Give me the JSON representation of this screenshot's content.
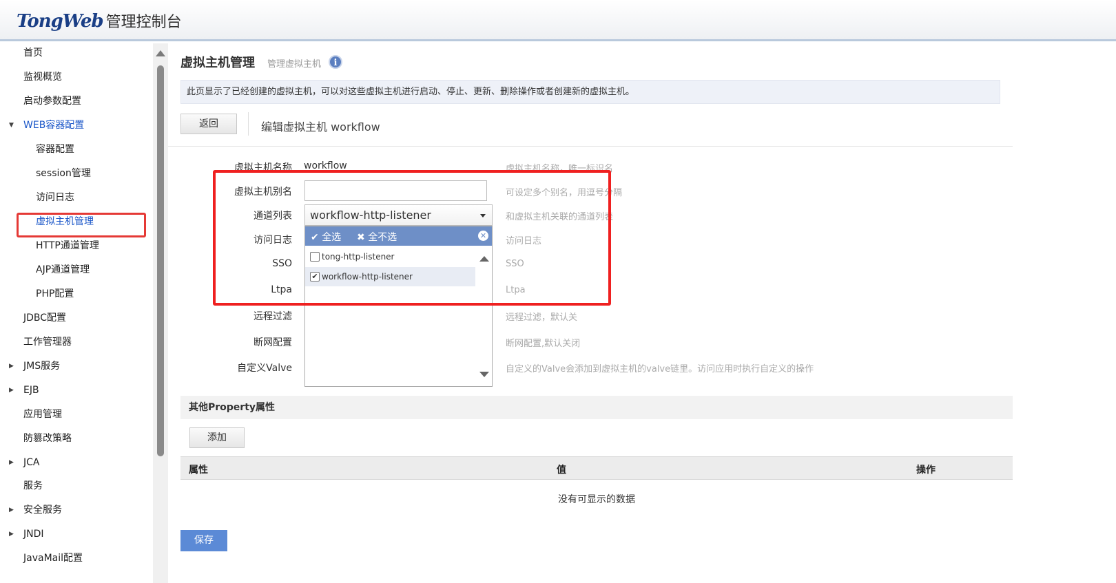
{
  "header": {
    "brand": "TongWeb",
    "suffix": "管理控制台"
  },
  "sidebar": {
    "items": [
      {
        "label": "首页"
      },
      {
        "label": "监视概览"
      },
      {
        "label": "启动参数配置"
      },
      {
        "label": "WEB容器配置",
        "expanded": true
      },
      {
        "label": "容器配置"
      },
      {
        "label": "session管理"
      },
      {
        "label": "访问日志"
      },
      {
        "label": "虚拟主机管理",
        "active": true
      },
      {
        "label": "HTTP通道管理"
      },
      {
        "label": "AJP通道管理"
      },
      {
        "label": "PHP配置"
      },
      {
        "label": "JDBC配置"
      },
      {
        "label": "工作管理器"
      },
      {
        "label": "JMS服务",
        "collapsed": true
      },
      {
        "label": "EJB",
        "collapsed": true
      },
      {
        "label": "应用管理"
      },
      {
        "label": "防篡改策略"
      },
      {
        "label": "JCA",
        "collapsed": true
      },
      {
        "label": "服务"
      },
      {
        "label": "安全服务",
        "collapsed": true
      },
      {
        "label": "JNDI",
        "collapsed": true
      },
      {
        "label": "JavaMail配置"
      }
    ]
  },
  "main": {
    "title": "虚拟主机管理",
    "subtitle": "管理虚拟主机",
    "description": "此页显示了已经创建的虚拟主机，可以对这些虚拟主机进行启动、停止、更新、删除操作或者创建新的虚拟主机。",
    "back_label": "返回",
    "edit_title": "编辑虚拟主机 workflow",
    "form": {
      "name_label": "虚拟主机名称",
      "name_value": "workflow",
      "name_hint": "虚拟主机名称，唯一标识名",
      "alias_label": "虚拟主机别名",
      "alias_value": "",
      "alias_hint": "可设定多个别名，用逗号分隔",
      "listener_label": "通道列表",
      "listener_value": "workflow-http-listener",
      "listener_hint": "和虚拟主机关联的通道列表",
      "access_log_label": "访问日志",
      "access_log_hint": "访问日志",
      "sso_label": "SSO",
      "sso_hint": "SSO",
      "ltpa_label": "Ltpa",
      "ltpa_hint": "Ltpa",
      "remote_filter_label": "远程过滤",
      "remote_filter_hint": "远程过滤，默认关",
      "disconnect_label": "断网配置",
      "disconnect_hint": "断网配置,默认关闭",
      "valve_label": "自定义Valve",
      "valve_hint": "自定义的Valve会添加到虚拟主机的valve链里。访问应用时执行自定义的操作"
    },
    "dropdown": {
      "select_all": "全选",
      "select_none": "全不选",
      "options": [
        {
          "label": "tong-http-listener",
          "checked": false
        },
        {
          "label": "workflow-http-listener",
          "checked": true
        }
      ]
    },
    "other_properties": {
      "title": "其他Property属性",
      "add_label": "添加",
      "columns": [
        "属性",
        "值",
        "操作"
      ],
      "empty_text": "没有可显示的数据"
    },
    "save_label": "保存"
  },
  "colors": {
    "highlight": "#ef2020",
    "accent": "#5b8ad6",
    "dropdown_header": "#6e8fc7"
  }
}
